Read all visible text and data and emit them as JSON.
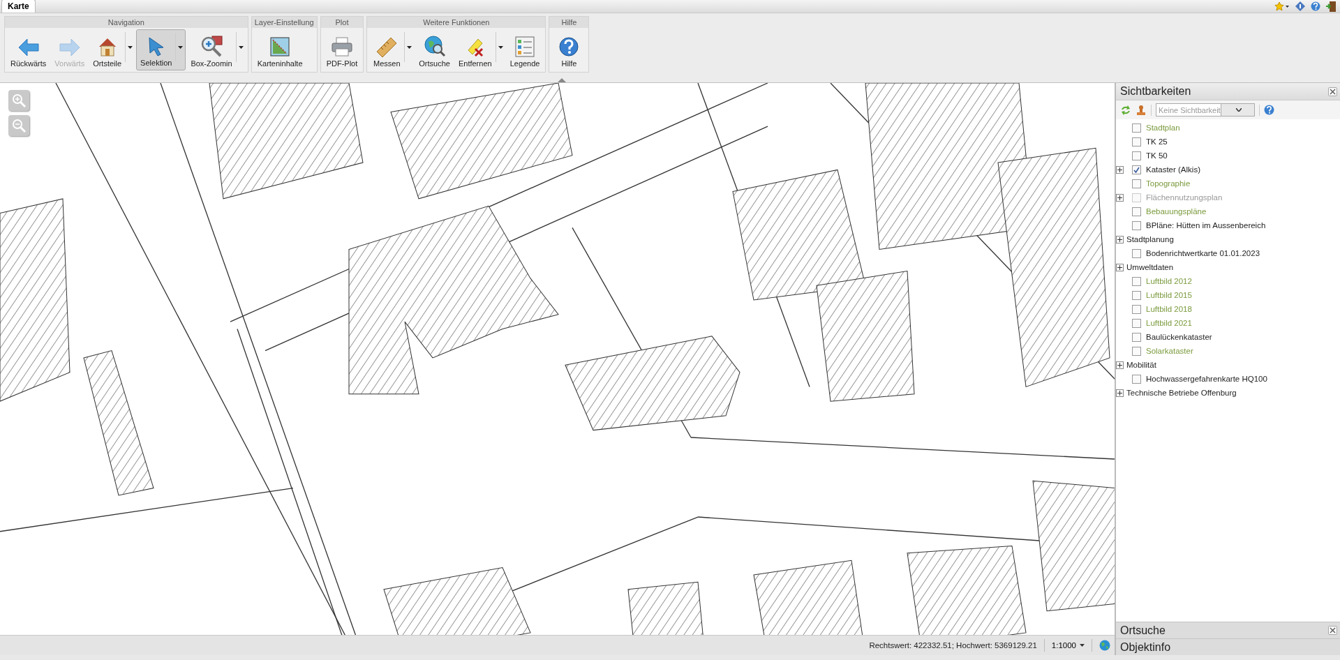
{
  "tabs": [
    {
      "label": "Karte",
      "selected": true
    }
  ],
  "toolbar": {
    "groups": [
      {
        "title": "Navigation",
        "buttons": [
          {
            "label": "Rückwärts",
            "disabled": false,
            "selected": false,
            "menu": false
          },
          {
            "label": "Vorwärts",
            "disabled": true,
            "selected": false,
            "menu": false
          },
          {
            "label": "Ortsteile",
            "disabled": false,
            "selected": false,
            "menu": true
          },
          {
            "label": "Selektion",
            "disabled": false,
            "selected": true,
            "menu": true
          },
          {
            "label": "Box-Zoomin",
            "disabled": false,
            "selected": false,
            "menu": true
          }
        ]
      },
      {
        "title": "Layer-Einstellung",
        "buttons": [
          {
            "label": "Karteninhalte",
            "disabled": false,
            "selected": false,
            "menu": false
          }
        ]
      },
      {
        "title": "Plot",
        "buttons": [
          {
            "label": "PDF-Plot",
            "disabled": false,
            "selected": false,
            "menu": false
          }
        ]
      },
      {
        "title": "Weitere Funktionen",
        "buttons": [
          {
            "label": "Messen",
            "disabled": false,
            "selected": false,
            "menu": true
          },
          {
            "label": "Ortsuche",
            "disabled": false,
            "selected": false,
            "menu": false
          },
          {
            "label": "Entfernen",
            "disabled": false,
            "selected": false,
            "menu": true
          },
          {
            "label": "Legende",
            "disabled": false,
            "selected": false,
            "menu": false
          }
        ]
      },
      {
        "title": "Hilfe",
        "buttons": [
          {
            "label": "Hilfe",
            "disabled": false,
            "selected": false,
            "menu": false
          }
        ]
      }
    ]
  },
  "sidebar": {
    "title": "Sichtbarkeiten",
    "select": {
      "placeholder": "Keine Sichtbarkeit"
    },
    "items": [
      {
        "kind": "layer",
        "label": "Stadtplan",
        "checked": false,
        "color": "#7a9a3c"
      },
      {
        "kind": "layer",
        "label": "TK 25",
        "checked": false,
        "color": "#222222"
      },
      {
        "kind": "layer",
        "label": "TK 50",
        "checked": false,
        "color": "#222222"
      },
      {
        "kind": "layer-group",
        "label": "Kataster (Alkis)",
        "checked": true,
        "expanded": false,
        "color": "#222222"
      },
      {
        "kind": "layer",
        "label": "Topographie",
        "checked": false,
        "color": "#7a9a3c"
      },
      {
        "kind": "layer-group",
        "label": "Flächennutzungsplan",
        "checked": false,
        "expanded": false,
        "color": "#999999"
      },
      {
        "kind": "layer",
        "label": "Bebauungspläne",
        "checked": false,
        "color": "#7a9a3c"
      },
      {
        "kind": "layer",
        "label": "BPläne: Hütten im Aussenbereich",
        "checked": false,
        "color": "#222222"
      },
      {
        "kind": "folder",
        "label": "Stadtplanung",
        "expanded": false,
        "color": "#222222"
      },
      {
        "kind": "layer",
        "label": "Bodenrichtwertkarte 01.01.2023",
        "checked": false,
        "color": "#222222"
      },
      {
        "kind": "folder",
        "label": "Umweltdaten",
        "expanded": false,
        "color": "#222222"
      },
      {
        "kind": "layer",
        "label": "Luftbild 2012",
        "checked": false,
        "color": "#7a9a3c"
      },
      {
        "kind": "layer",
        "label": "Luftbild 2015",
        "checked": false,
        "color": "#7a9a3c"
      },
      {
        "kind": "layer",
        "label": "Luftbild 2018",
        "checked": false,
        "color": "#7a9a3c"
      },
      {
        "kind": "layer",
        "label": "Luftbild 2021",
        "checked": false,
        "color": "#7a9a3c"
      },
      {
        "kind": "layer",
        "label": "Baulückenkataster",
        "checked": false,
        "color": "#222222"
      },
      {
        "kind": "layer",
        "label": "Solarkataster",
        "checked": false,
        "color": "#7a9a3c"
      },
      {
        "kind": "folder",
        "label": "Mobilität",
        "expanded": false,
        "color": "#222222"
      },
      {
        "kind": "layer",
        "label": "Hochwassergefahrenkarte HQ100",
        "checked": false,
        "color": "#222222"
      },
      {
        "kind": "folder",
        "label": "Technische Betriebe Offenburg",
        "expanded": false,
        "color": "#222222"
      }
    ]
  },
  "panels": [
    {
      "title": "Ortsuche",
      "closable": true
    },
    {
      "title": "Objektinfo",
      "closable": false
    }
  ],
  "status_bar": {
    "coordinates": "Rechtswert: 422332.51; Hochwert: 5369129.21",
    "scale": "1:1000"
  }
}
